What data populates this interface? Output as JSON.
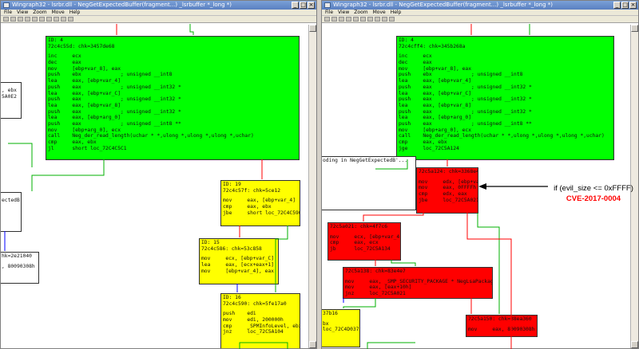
{
  "left_window": {
    "title": "Wingraph32 - lsrbr.dll - NegGetExpectedBuffer(fragment...) _lsrbuffer *_long *)",
    "menu": [
      "File",
      "View",
      "Zoom",
      "Move",
      "Help"
    ],
    "block_main": {
      "lines": [
        "ID: 4",
        "72c4c55d: chk=3457de68",
        "",
        "inc     ecx",
        "dec     eax",
        "mov     [ebp+var_8], eax",
        "push    ebx             ; unsigned __int8",
        "lea     eax, [ebp+var_4]",
        "push    eax             ; unsigned __int32 *",
        "lea     eax, [ebp+var_C]",
        "push    eax             ; unsigned __int32 *",
        "lea     eax, [ebp+var_8]",
        "push    eax             ; unsigned __int32 *",
        "lea     eax, [ebp+arg_0]",
        "push    eax             ; unsigned __int8 **",
        "mov     [ebp+arg_0], ecx",
        "call    Neg_der_read_length(uchar * *,ulong *,ulong *,ulong *,uchar)",
        "cmp     eax, ebx",
        "jl      short loc_72C4C5C1"
      ]
    },
    "block_19": {
      "lines": [
        "ID: 19",
        "72c4c57f: chk=5ce12",
        "",
        "mov     eax, [ebp+var_4]",
        "cmp     eax, ebx",
        "jbe     short loc_72C4C590"
      ]
    },
    "block_15": {
      "lines": [
        "ID: 15",
        "72c4c586: chk=53c858",
        "",
        "mov     ecx, [ebp+var_C]",
        "lea     eax, [ecx+eax+1]",
        "mov     [ebp+var_4], eax"
      ]
    },
    "block_16": {
      "lines": [
        "ID: 16",
        "72c4c590: chk=5fe17a0",
        "",
        "push    edi",
        "mov     edi, 200000h",
        "cmp     _SPMInfoLevel, ebx",
        "jnz     loc_72C5A104"
      ]
    },
    "partial_left_1": {
      "lines": [
        "",
        ", ebx",
        "5A0E2"
      ]
    },
    "partial_left_2": {
      "lines": [
        "",
        "ectedB'..."
      ]
    },
    "partial_left_3": {
      "lines": [
        "hk=2e21040",
        "",
        ", 80090308h"
      ]
    }
  },
  "right_window": {
    "title": "Wingraph32 - lsrbr.dll - NegGetExpectedBuffer(fragment...) _lsrbuffer *_long *)",
    "menu": [
      "File",
      "View",
      "Zoom",
      "Move",
      "Help"
    ],
    "block_main": {
      "lines": [
        "ID: 4",
        "72c4cff4: chk=345b268a",
        "",
        "inc     ecx",
        "dec     eax",
        "mov     [ebp+var_8], eax",
        "push    ebx             ; unsigned __int8",
        "lea     eax, [ebp+var_4]",
        "push    eax             ; unsigned __int32 *",
        "lea     eax, [ebp+var_C]",
        "push    eax             ; unsigned __int32 *",
        "lea     eax, [ebp+var_8]",
        "push    eax             ; unsigned __int32 *",
        "lea     eax, [ebp+arg_0]",
        "push    eax             ; unsigned __int8 **",
        "mov     [ebp+arg_0], ecx",
        "call    Neg_der_read_length(uchar * *,ulong *,ulong *,ulong *,uchar)",
        "cmp     eax, ebx",
        "jge     loc_72C5A124"
      ]
    },
    "block_red_1": {
      "lines": [
        "72c5a124: chk=3368e4a",
        "",
        "mov     edx, [ebp+var_4]",
        "mov     eax, 0FFFFh",
        "cmp     edx, eax",
        "jbe     loc_72C5A021"
      ]
    },
    "block_red_2": {
      "lines": [
        "72c5a021: chk=4f7c6",
        "",
        "mov     ecx, [ebp+var_4]",
        "cmp     eax, ecx",
        "jb      loc_72C5A134"
      ]
    },
    "block_red_3": {
      "lines": [
        "72c5a138: chk=83e4e7",
        "",
        "mov     eax, _SMP_SECURITY_PACKAGE * NegLsaPackage",
        "mov     eax, [eax+10h]",
        "jnz     loc_72C5A021"
      ]
    },
    "block_red_4": {
      "lines": [
        "72c5a150: chk=38ea360",
        "",
        "mov     eax, 80090308h"
      ]
    },
    "partial_yellow": {
      "lines": [
        "37b16",
        "",
        "bx",
        "loc_72C4D037"
      ]
    },
    "partial_white": {
      "lines": [
        "oding in NegGetExpectedB'..."
      ]
    }
  },
  "annotation": {
    "condition": "if (evil_size <= 0xFFFF)",
    "cve": "CVE-2017-0004"
  },
  "colors": {
    "green": "#00ff00",
    "yellow": "#ffff00",
    "red": "#ff0000",
    "edge_red": "#ff0000",
    "edge_green": "#00b000",
    "edge_blue": "#0000ff"
  }
}
